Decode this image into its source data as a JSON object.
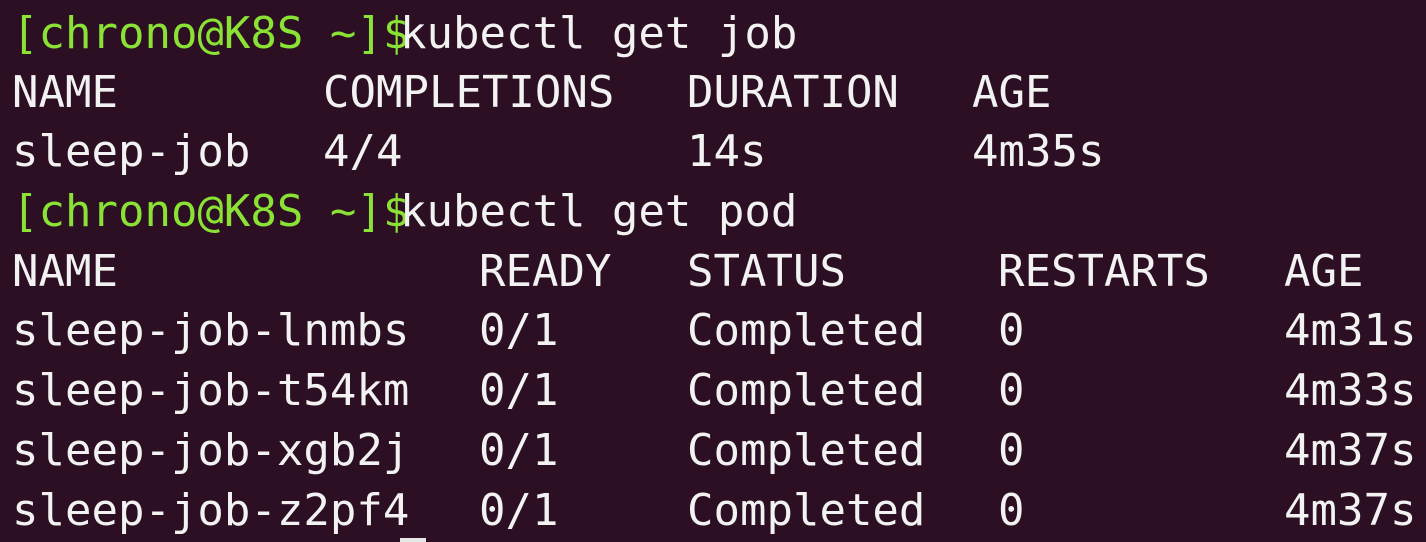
{
  "terminal": {
    "commands": [
      {
        "prompt": "[chrono@K8S ~]$",
        "text": "kubectl get job"
      },
      {
        "prompt": "[chrono@K8S ~]$",
        "text": "kubectl get pod"
      }
    ],
    "job_table": {
      "headers": [
        "NAME",
        "COMPLETIONS",
        "DURATION",
        "AGE"
      ],
      "rows": [
        [
          "sleep-job",
          "4/4",
          "14s",
          "4m35s"
        ]
      ]
    },
    "pod_table": {
      "headers": [
        "NAME",
        "READY",
        "STATUS",
        "RESTARTS",
        "AGE"
      ],
      "rows": [
        [
          "sleep-job-lnmbs",
          "0/1",
          "Completed",
          "0",
          "4m31s"
        ],
        [
          "sleep-job-t54km",
          "0/1",
          "Completed",
          "0",
          "4m33s"
        ],
        [
          "sleep-job-xgb2j",
          "0/1",
          "Completed",
          "0",
          "4m37s"
        ],
        [
          "sleep-job-z2pf4",
          "0/1",
          "Completed",
          "0",
          "4m37s"
        ]
      ]
    }
  },
  "colors": {
    "background": "#2c0f22",
    "prompt": "#8ae234",
    "text": "#f2f2f2"
  }
}
